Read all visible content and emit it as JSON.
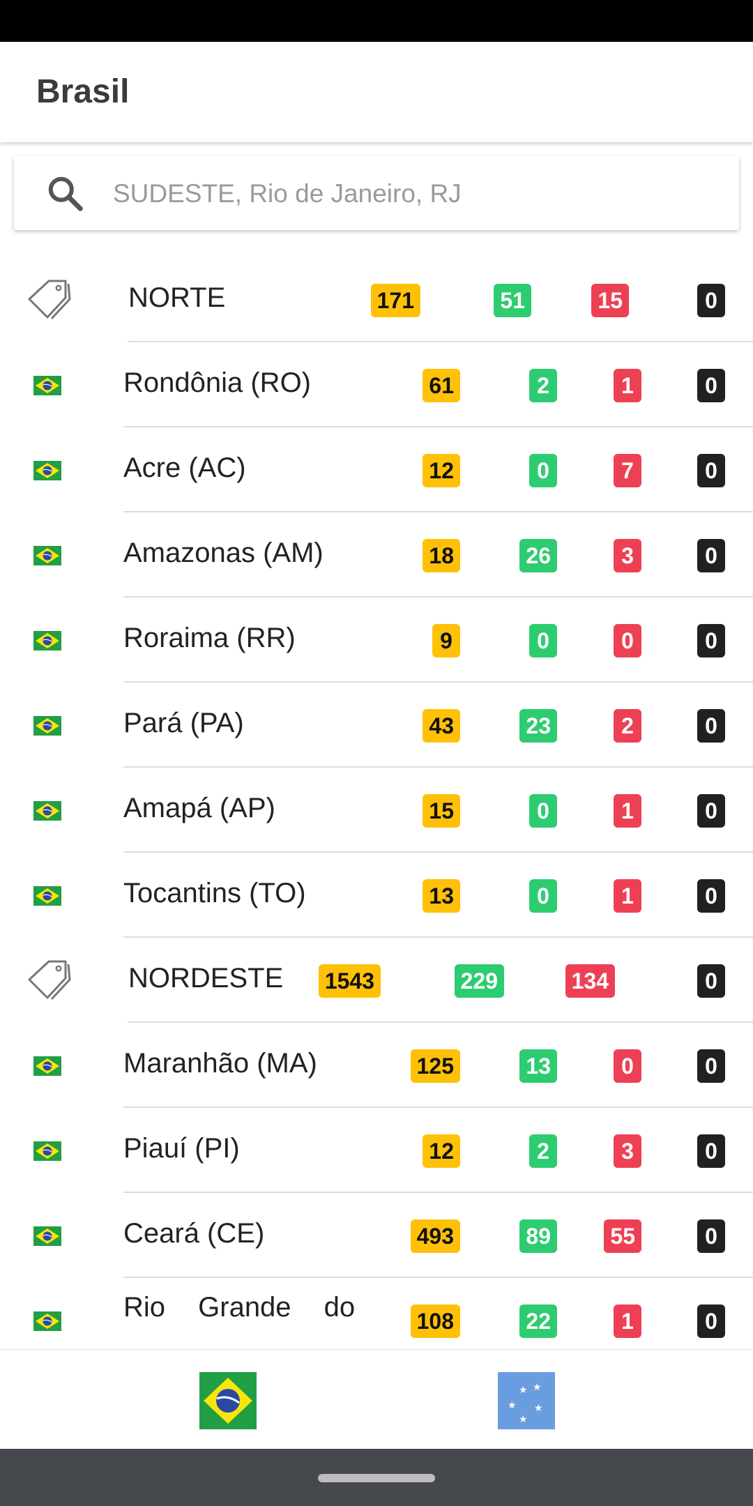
{
  "app": {
    "title": "Brasil"
  },
  "search": {
    "placeholder": "SUDESTE, Rio de Janeiro, RJ",
    "value": ""
  },
  "colors": {
    "confirmed": "#ffc107",
    "recovered": "#2ecc71",
    "deaths": "#ee4054",
    "other": "#212121",
    "flag_green": "#229e45",
    "flag_yellow": "#f8e509",
    "flag_blue": "#2b49a3",
    "mercosul_blue": "#6a9de0"
  },
  "list": {
    "rows": [
      {
        "type": "region",
        "name": "NORTE",
        "confirmed": "171",
        "recovered": "51",
        "deaths": "15",
        "other": "0"
      },
      {
        "type": "state",
        "name": "Rondônia (RO)",
        "confirmed": "61",
        "recovered": "2",
        "deaths": "1",
        "other": "0"
      },
      {
        "type": "state",
        "name": "Acre (AC)",
        "confirmed": "12",
        "recovered": "0",
        "deaths": "7",
        "other": "0"
      },
      {
        "type": "state",
        "name": "Amazonas (AM)",
        "confirmed": "18",
        "recovered": "26",
        "deaths": "3",
        "other": "0"
      },
      {
        "type": "state",
        "name": "Roraima (RR)",
        "confirmed": "9",
        "recovered": "0",
        "deaths": "0",
        "other": "0"
      },
      {
        "type": "state",
        "name": "Pará (PA)",
        "confirmed": "43",
        "recovered": "23",
        "deaths": "2",
        "other": "0"
      },
      {
        "type": "state",
        "name": "Amapá (AP)",
        "confirmed": "15",
        "recovered": "0",
        "deaths": "1",
        "other": "0"
      },
      {
        "type": "state",
        "name": "Tocantins (TO)",
        "confirmed": "13",
        "recovered": "0",
        "deaths": "1",
        "other": "0"
      },
      {
        "type": "region",
        "name": "NORDESTE",
        "confirmed": "1543",
        "recovered": "229",
        "deaths": "134",
        "other": "0"
      },
      {
        "type": "state",
        "name": "Maranhão (MA)",
        "confirmed": "125",
        "recovered": "13",
        "deaths": "0",
        "other": "0"
      },
      {
        "type": "state",
        "name": "Piauí (PI)",
        "confirmed": "12",
        "recovered": "2",
        "deaths": "3",
        "other": "0"
      },
      {
        "type": "state",
        "name": "Ceará (CE)",
        "confirmed": "493",
        "recovered": "89",
        "deaths": "55",
        "other": "0"
      },
      {
        "type": "state",
        "name": "Rio Grande do",
        "confirmed": "108",
        "recovered": "22",
        "deaths": "1",
        "other": "0",
        "partial": true
      }
    ]
  },
  "bottom_nav": {
    "tabs": [
      {
        "id": "brasil",
        "icon": "brazil-flag-icon"
      },
      {
        "id": "mercosul",
        "icon": "mercosul-flag-icon"
      }
    ]
  }
}
